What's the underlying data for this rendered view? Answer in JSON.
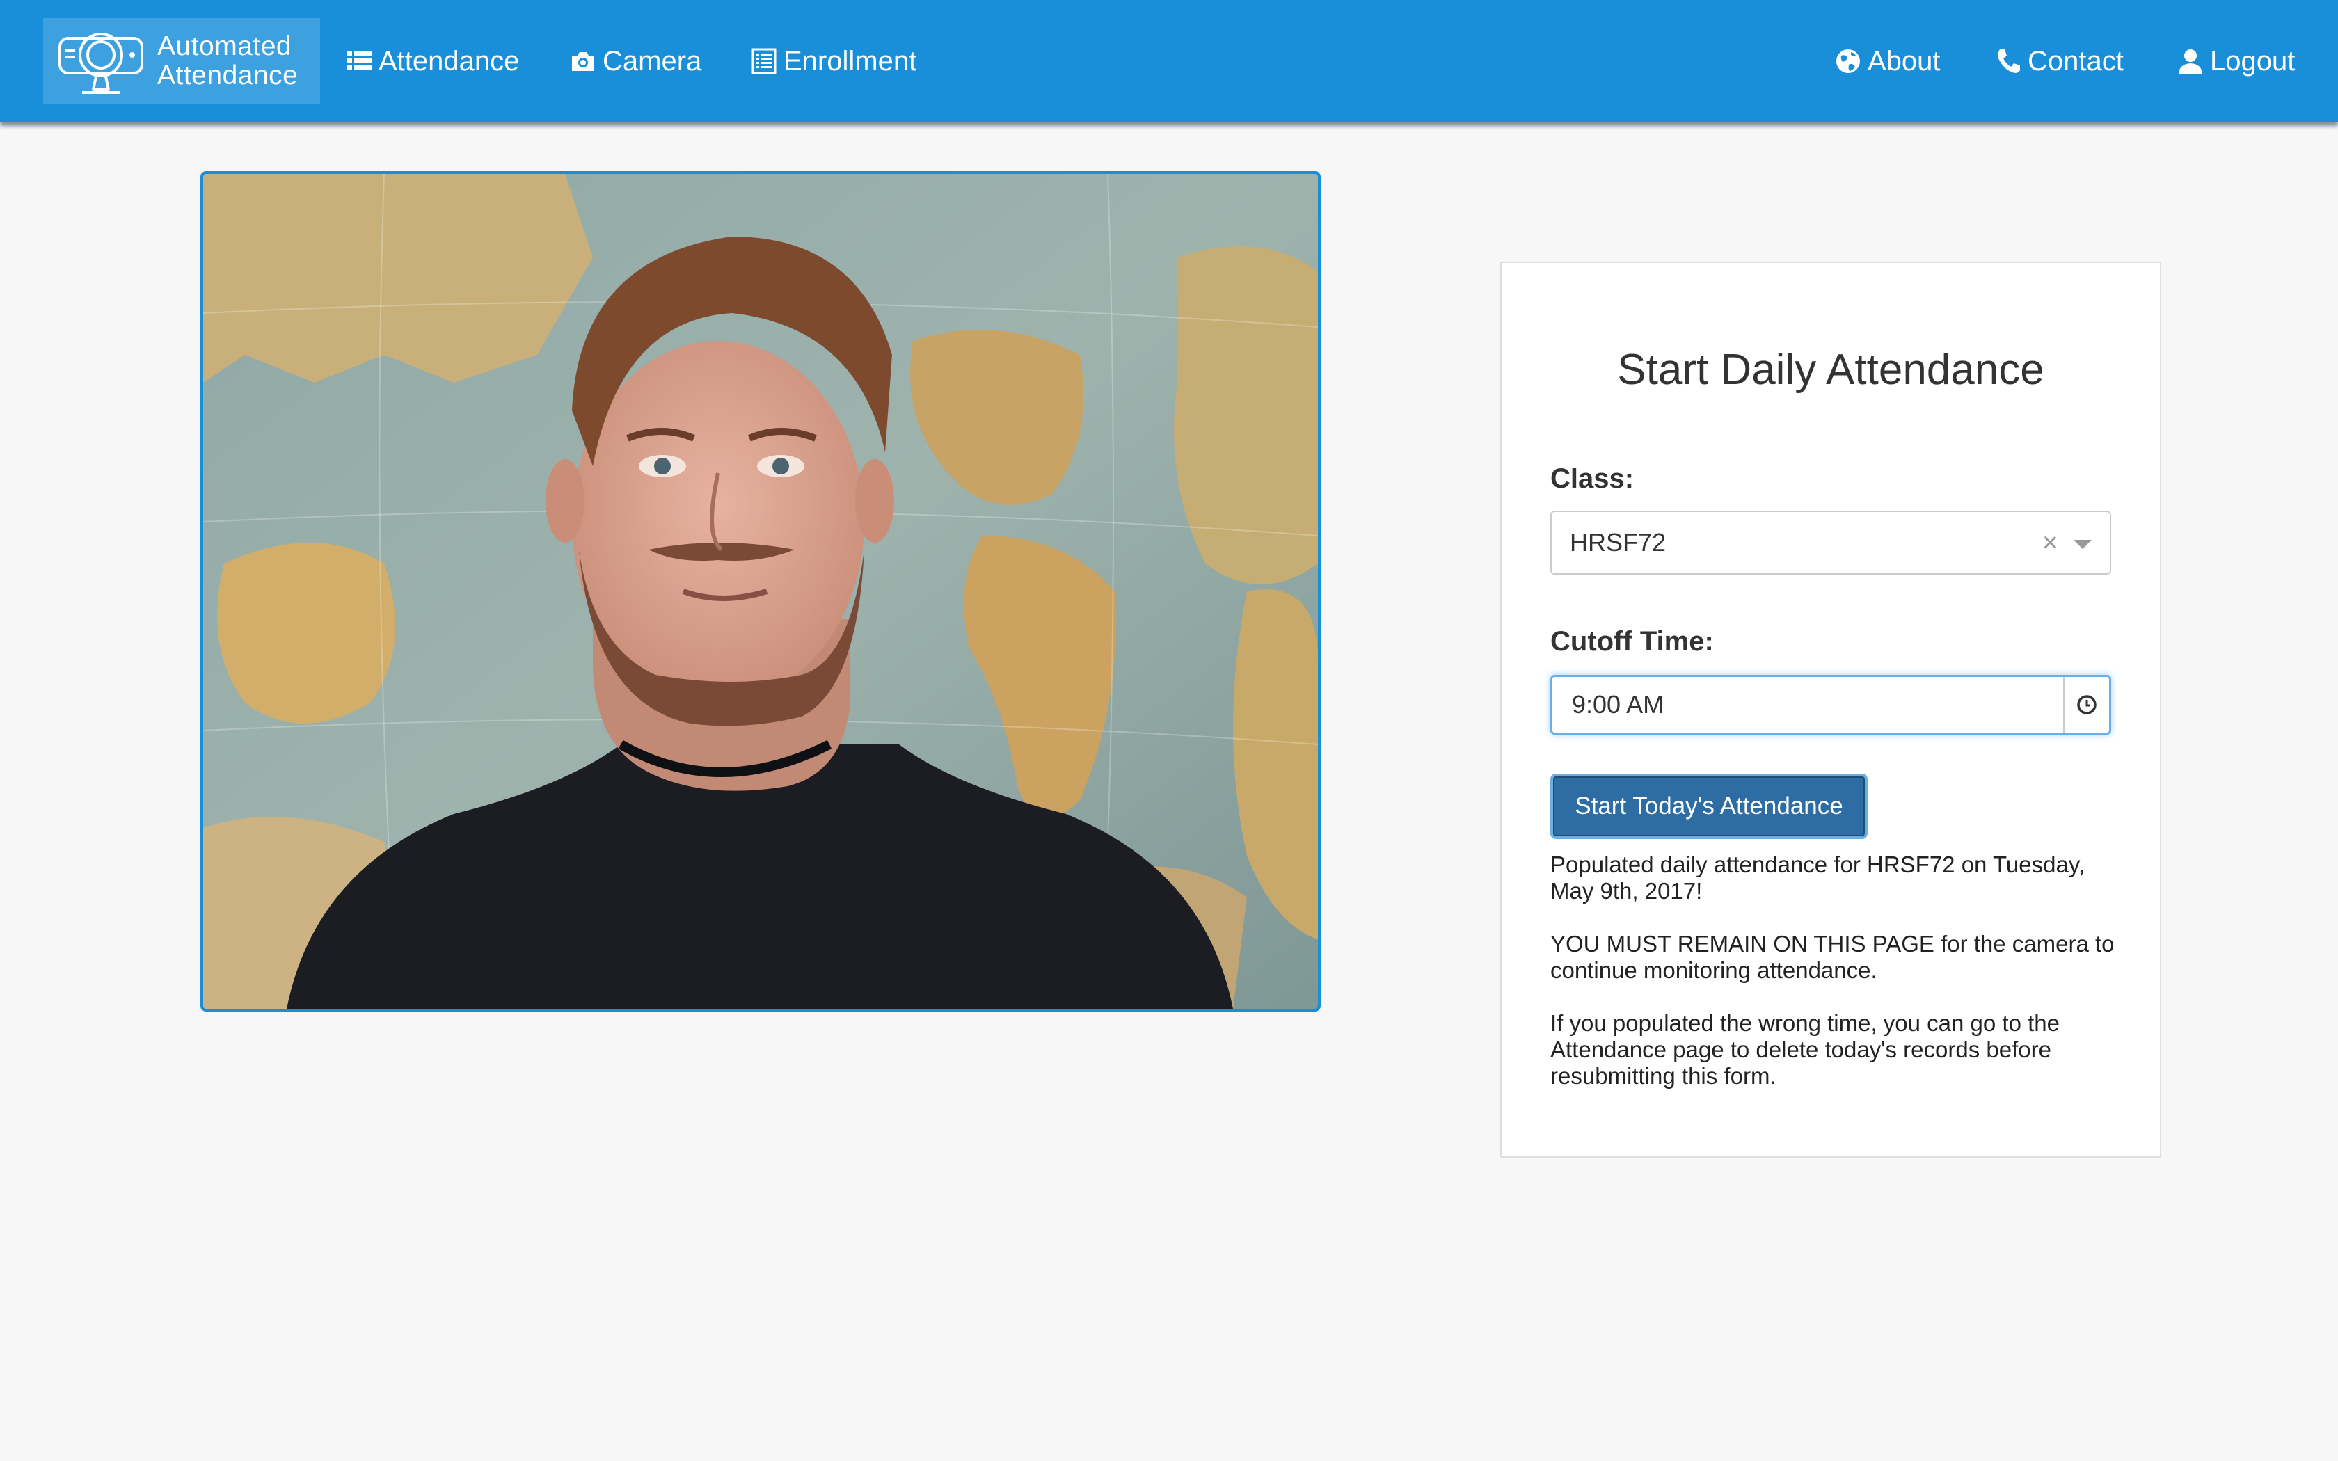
{
  "navbar": {
    "brand_line1": "Automated",
    "brand_line2": "Attendance",
    "brand_logo_icon": "camera-robot-logo-icon",
    "left_items": [
      {
        "label": "Attendance",
        "icon": "list-icon"
      },
      {
        "label": "Camera",
        "icon": "camera-icon"
      },
      {
        "label": "Enrollment",
        "icon": "list-alt-icon"
      }
    ],
    "right_items": [
      {
        "label": "About",
        "icon": "globe-icon"
      },
      {
        "label": "Contact",
        "icon": "phone-icon"
      },
      {
        "label": "Logout",
        "icon": "user-icon"
      }
    ],
    "color": "#1a8fd9"
  },
  "camera": {
    "feed": "live webcam feed"
  },
  "form": {
    "title": "Start Daily Attendance",
    "class_label": "Class:",
    "class_value": "HRSF72",
    "class_clear": "×",
    "cutoff_label": "Cutoff Time:",
    "cutoff_value": "9:00 AM",
    "submit_label": "Start Today's Attendance",
    "accent_color": "#2e6da4"
  },
  "messages": [
    "Populated daily attendance for HRSF72 on Tuesday, May 9th, 2017!",
    "YOU MUST REMAIN ON THIS PAGE for the camera to continue monitoring attendance.",
    "If you populated the wrong time, you can go to the Attendance page to delete today's records before resubmitting this form."
  ]
}
